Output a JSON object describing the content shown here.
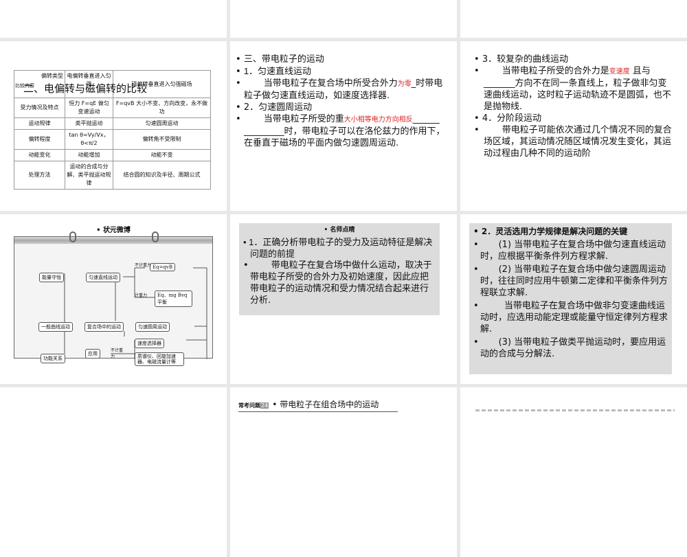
{
  "slide1": {
    "title": "二、电偏转与磁偏转的比较",
    "header_type": "偏转类型",
    "header_compare": "比较内容",
    "col_e": "电偏转垂直进入匀强",
    "col_m": "磁偏转垂直进入匀强磁场",
    "rows": [
      [
        "受力情况及特点",
        "恒力 F=qE 做匀变速运动",
        "F=qvB 大小不变、方向改变，永不做功"
      ],
      [
        "运动规律",
        "类平抛运动",
        "匀速圆周运动"
      ],
      [
        "偏转程度",
        "tan θ=Vy/Vx，θ<π/2",
        "偏转角不受限制"
      ],
      [
        "动能变化",
        "动能增加",
        "动能不变"
      ],
      [
        "处理方法",
        "运动的合成与分解、类平抛运动规律",
        "结合圆的知识及半径、周期公式"
      ]
    ]
  },
  "slide2": {
    "l1": "三、带电粒子的运动",
    "l2": "1．匀速直线运动",
    "l3a": "当带电粒子在复合场中所受合外力",
    "l3red": "为零",
    "l3b": "_时带电粒子做匀速直线运动，如速度选择器.",
    "l4": "2．匀速圆周运动",
    "l5a": "当带电粒子所受的重",
    "l5red": "大小相等电力方向相反",
    "l5b": "时，带电粒子可以在洛伦兹力的作用下，在垂直于磁场的平面内做匀速圆周运动."
  },
  "slide3": {
    "l1": "3．较复杂的曲线运动",
    "l2a": "当带电粒子所受的合外力是",
    "l2red": "变速度",
    "l2b": "且与_______方向不在同一条直线上，粒子做非匀变速曲线运动，这时粒子运动轨迹不是圆弧，也不是抛物线.",
    "l3": "4．分阶段运动",
    "l4": "带电粒子可能依次通过几个情况不同的复合场区域，其运动情况随区域情况发生变化，其运动过程由几种不同的运动阶"
  },
  "slide4": {
    "title": "状元微博",
    "nodes": {
      "energy": "能量守恒",
      "uniform_line": "匀速直线运动",
      "eq_qvb": "Eq=qvB",
      "eq_mg": "Eq、mg Bvq平衡",
      "general_curve": "一般曲线运动",
      "compound": "复合场中的运动",
      "uniform_circle": "匀速圆周运动",
      "kinetic": "功能关系",
      "apply": "应用",
      "selector": "速度选择器",
      "instruments": "质谱仪、回旋加速器、电磁流量计等"
    },
    "labels": {
      "no_gravity": "不计重力",
      "gravity": "计重力"
    }
  },
  "slide5": {
    "title": "名师点睛",
    "l1": "1．正确分析带电粒子的受力及运动特征是解决问题的前提",
    "l2": "带电粒子在复合场中做什么运动，取决于带电粒子所受的合外力及初始速度，因此应把带电粒子的运动情况和受力情况结合起来进行分析."
  },
  "slide6": {
    "l1": "2．灵活选用力学规律是解决问题的关键",
    "l2": "(1) 当带电粒子在复合场中做匀速直线运动时，应根据平衡条件列方程求解.",
    "l3": "(2) 当带电粒子在复合场中做匀速圆周运动时，往往同时应用牛顿第二定律和平衡条件列方程联立求解.",
    "l4": "当带电粒子在复合场中做非匀变速曲线运动时，应选用动能定理或能量守恒定律列方程求解.",
    "l5": "(3) 当带电粒子做类平抛运动时，要应用运动的合成与分解法."
  },
  "slide8": {
    "label": "常考问题",
    "num": "24",
    "title": "带电粒子在组合场中的运动"
  }
}
